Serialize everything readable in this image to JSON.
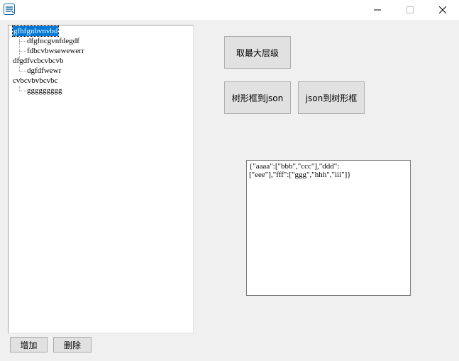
{
  "window": {
    "icon": "app-icon",
    "controls": {
      "minimize": "minimize-icon",
      "maximize": "maximize-icon",
      "close": "close-icon"
    }
  },
  "tree": {
    "nodes": [
      {
        "label": "gfhfgnbvnvbd",
        "level": 0,
        "selected": true
      },
      {
        "label": "dfgfncgvnfdegdf",
        "level": 1
      },
      {
        "label": "fdbcvbwsewewerr",
        "level": 1
      },
      {
        "label": "dfgdfvcbcvbcvb",
        "level": 0
      },
      {
        "label": "dgfdfwewr",
        "level": 1
      },
      {
        "label": "cvbcvbvbcvbc",
        "level": 0
      },
      {
        "label": "ggggggggg",
        "level": 1
      }
    ]
  },
  "buttons": {
    "max_level": "取最大层级",
    "tree_to_json": "树形框到json",
    "json_to_tree": "json到树形框",
    "add": "增加",
    "delete": "删除"
  },
  "json_text": "{\"aaaa\":[\"bbb\",\"ccc\"],\"ddd\":\n[\"eee\"],\"fff\":[\"ggg\",\"hhh\",\"iii\"]}",
  "colors": {
    "selection": "#0078d7",
    "window_bg": "#f0f0f0",
    "button_bg": "#e1e1e1"
  }
}
